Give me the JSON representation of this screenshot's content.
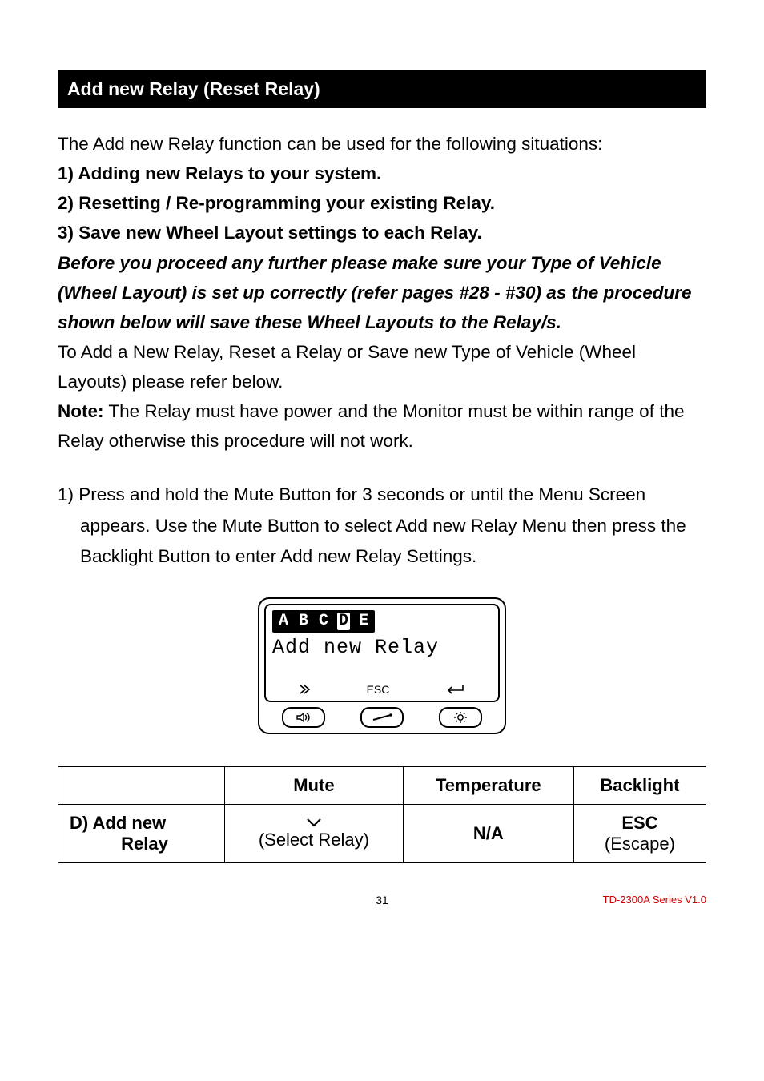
{
  "header": "Add new Relay (Reset Relay)",
  "intro": "The Add new Relay function can be used for the following situations:",
  "situations": [
    "1) Adding new Relays to your system.",
    "2) Resetting / Re-programming your existing Relay.",
    "3) Save new Wheel Layout settings to each Relay."
  ],
  "warning": "Before you proceed any further please make sure your Type of Vehi­cle (Wheel Layout) is set up correctly (refer pages #28 - #30) as the procedure shown below will save these Wheel Layouts to the Relay/s.",
  "after_warning": "To Add a New Relay, Reset a Relay or Save new Type of Vehicle (Wheel Layouts) please refer below.",
  "note_label": "Note:",
  "note_body": " The Relay must have power and the Monitor must be within range of the Relay otherwise this procedure will not work.",
  "step1": "1) Press and hold the Mute Button for 3 seconds or until the Menu Screen ",
  "step1_cont": "appears. Use the Mute Button to select Add new Relay Menu then press the Backlight Button to enter Add new Relay Settings.",
  "lcd": {
    "tabs": [
      "A",
      "B",
      "C",
      "D",
      "E"
    ],
    "selected_index": 3,
    "title": "Add new Relay",
    "hint_mid": "ESC"
  },
  "table": {
    "headers": [
      "",
      "Mute",
      "Temperature",
      "Backlight"
    ],
    "row": {
      "label_l1": "D) Add new",
      "label_l2": "Relay",
      "mute": "(Select Relay)",
      "temp": "N/A",
      "back_l1": "ESC",
      "back_l2": "(Escape)"
    }
  },
  "footer": {
    "page": "31",
    "version": "TD-2300A Series V1.0"
  },
  "chart_data": {
    "type": "table",
    "headers": [
      "",
      "Mute",
      "Temperature",
      "Backlight"
    ],
    "rows": [
      [
        "D) Add new Relay",
        "⌄ (Select Relay)",
        "N/A",
        "ESC (Escape)"
      ]
    ]
  }
}
